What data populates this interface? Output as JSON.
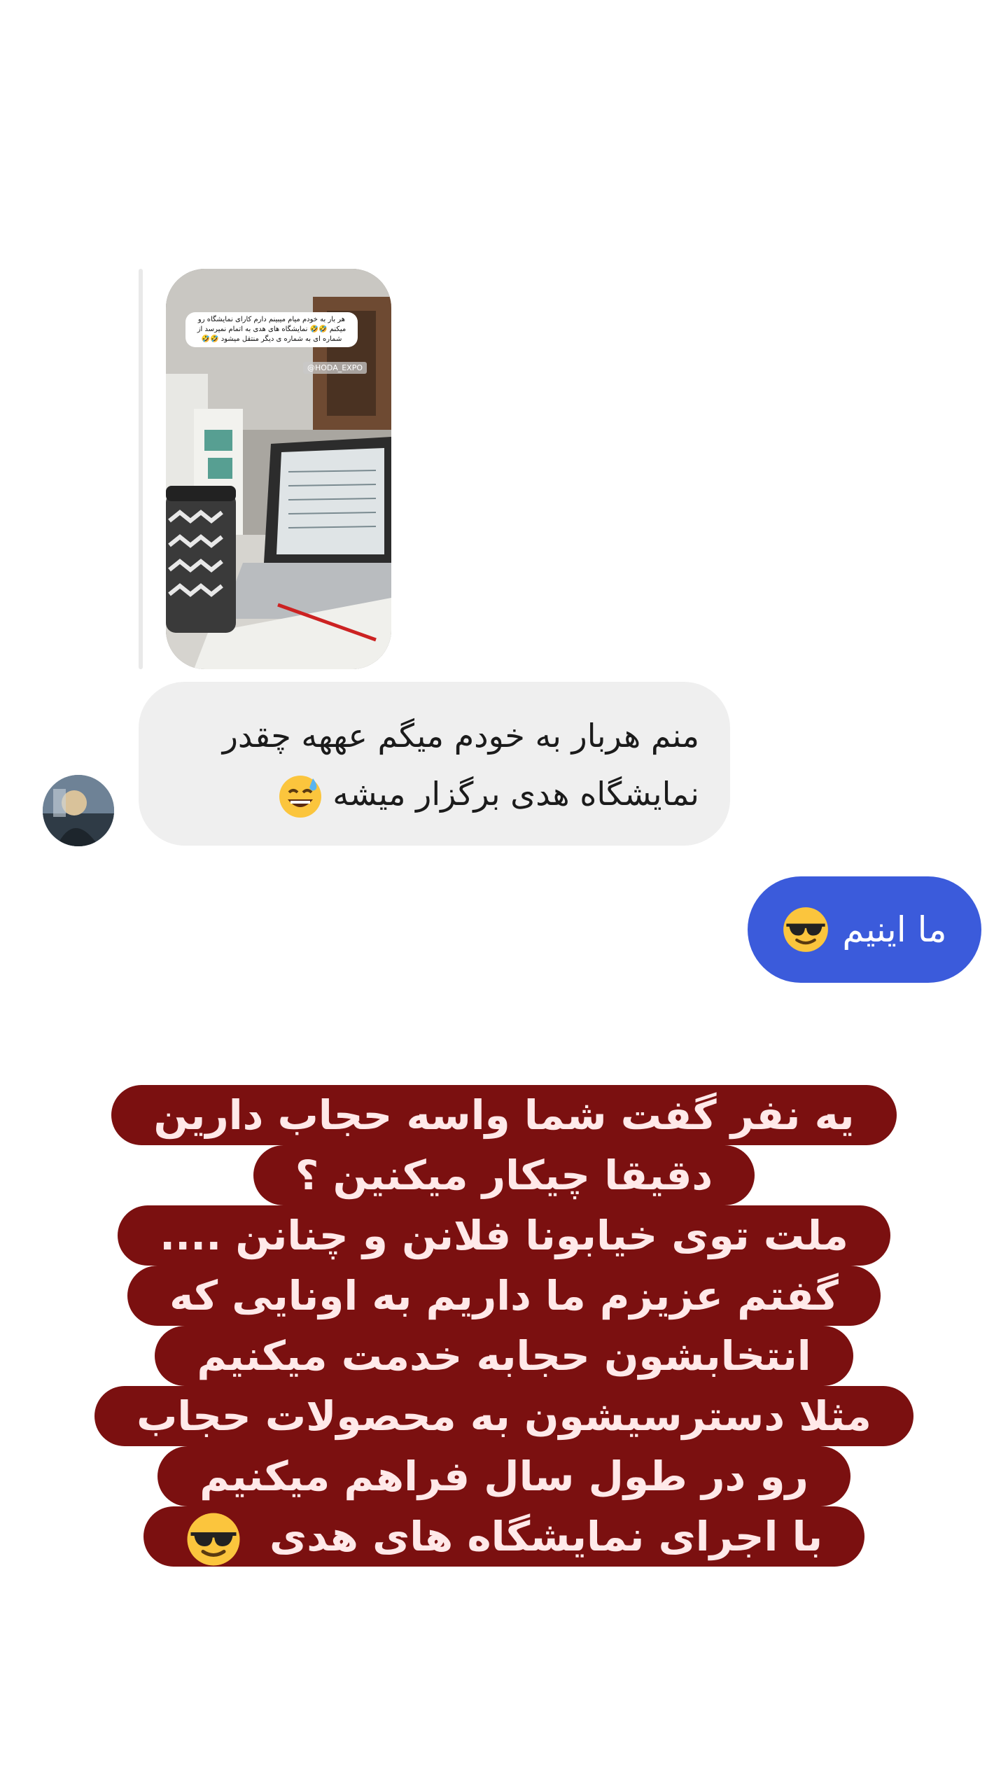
{
  "story_reply": {
    "caption": "هر بار به خودم میام میبینم دارم کارای نمایشگاه رو میکنم 🤣🤣 نمایشگاه های هدی به اتمام نمیرسد از شماره ای به شماره ی دیگر منتقل میشود 🤣🤣",
    "tag": "@HODA_EXPO"
  },
  "messages": [
    {
      "direction": "incoming",
      "text_line1": "منم هربار به خودم میگم عههه چقدر",
      "text_line2": "نمایشگاه هدی برگزار میشه",
      "emoji": "sweat-smile"
    },
    {
      "direction": "outgoing",
      "text": "ما اینیم",
      "emoji": "sunglasses"
    }
  ],
  "overlay_text": {
    "lines": [
      "یه نفر گفت شما واسه حجاب دارین",
      "دقیقا چیکار میکنین ؟",
      "ملت توی خیابونا فلانن و چنانن ....",
      "گفتم عزیزم ما داریم به اونایی که",
      "انتخابشون حجابه خدمت میکنیم",
      "مثلا دسترسیشون به محصولات حجاب",
      "رو در طول سال فراهم میکنیم",
      "با اجرای نمایشگاه های هدی"
    ],
    "last_line_emoji": "sunglasses",
    "highlight_color": "#7b1010",
    "text_color": "#ffe9e9"
  },
  "colors": {
    "incoming_bubble": "#efefef",
    "outgoing_bubble": "#3b5bdb"
  }
}
